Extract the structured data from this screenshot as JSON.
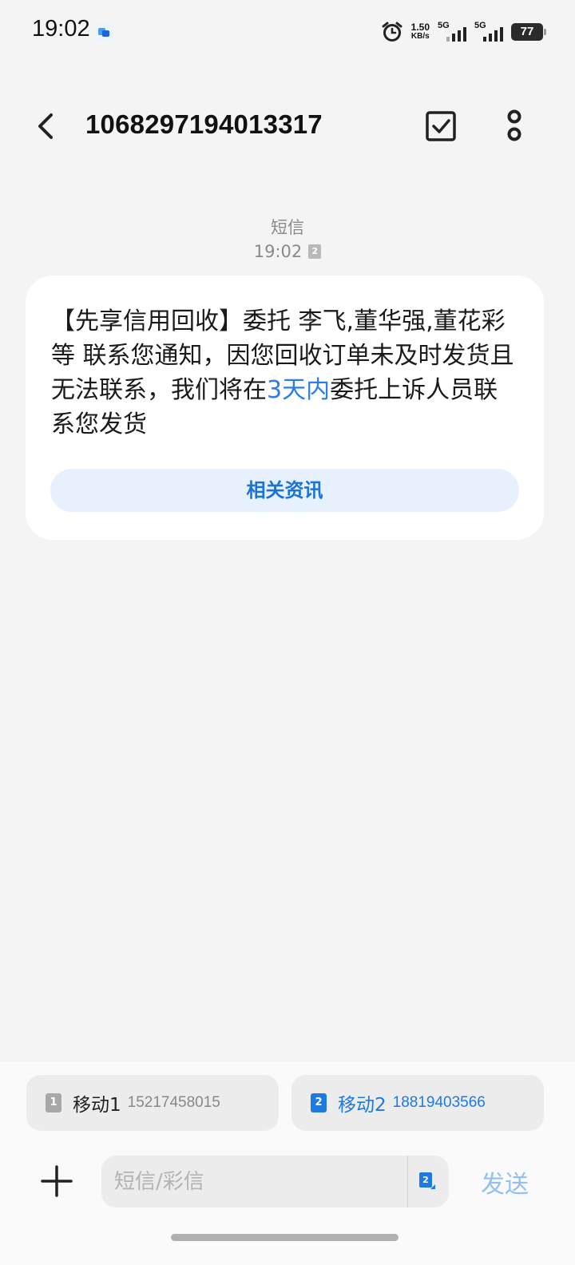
{
  "status_bar": {
    "time": "19:02",
    "net_speed_value": "1.50",
    "net_speed_unit": "KB/s",
    "sim1_network": "5G",
    "sim2_network": "5G",
    "battery": "77"
  },
  "header": {
    "title": "1068297194013317"
  },
  "message": {
    "type_label": "短信",
    "time": "19:02",
    "sim_index": "2",
    "text_part1": "【先享信用回收】委托 李飞,董华强,董花彩等 联系您通知，因您回收订单未及时发货且无法联系，我们将在",
    "text_highlight": "3天内",
    "text_part2": "委托上诉人员联系您发货",
    "related_button": "相关资讯"
  },
  "sim_selector": {
    "sim1": {
      "index": "1",
      "name": "移动1",
      "number": "15217458015"
    },
    "sim2": {
      "index": "2",
      "name": "移动2",
      "number": "18819403566"
    }
  },
  "composer": {
    "placeholder": "短信/彩信",
    "sim_index": "2",
    "send_label": "发送"
  },
  "colors": {
    "accent": "#1f7ae0",
    "link": "#2a7ee6",
    "send_disabled": "#92c0f3",
    "background": "#f4f4f4"
  }
}
